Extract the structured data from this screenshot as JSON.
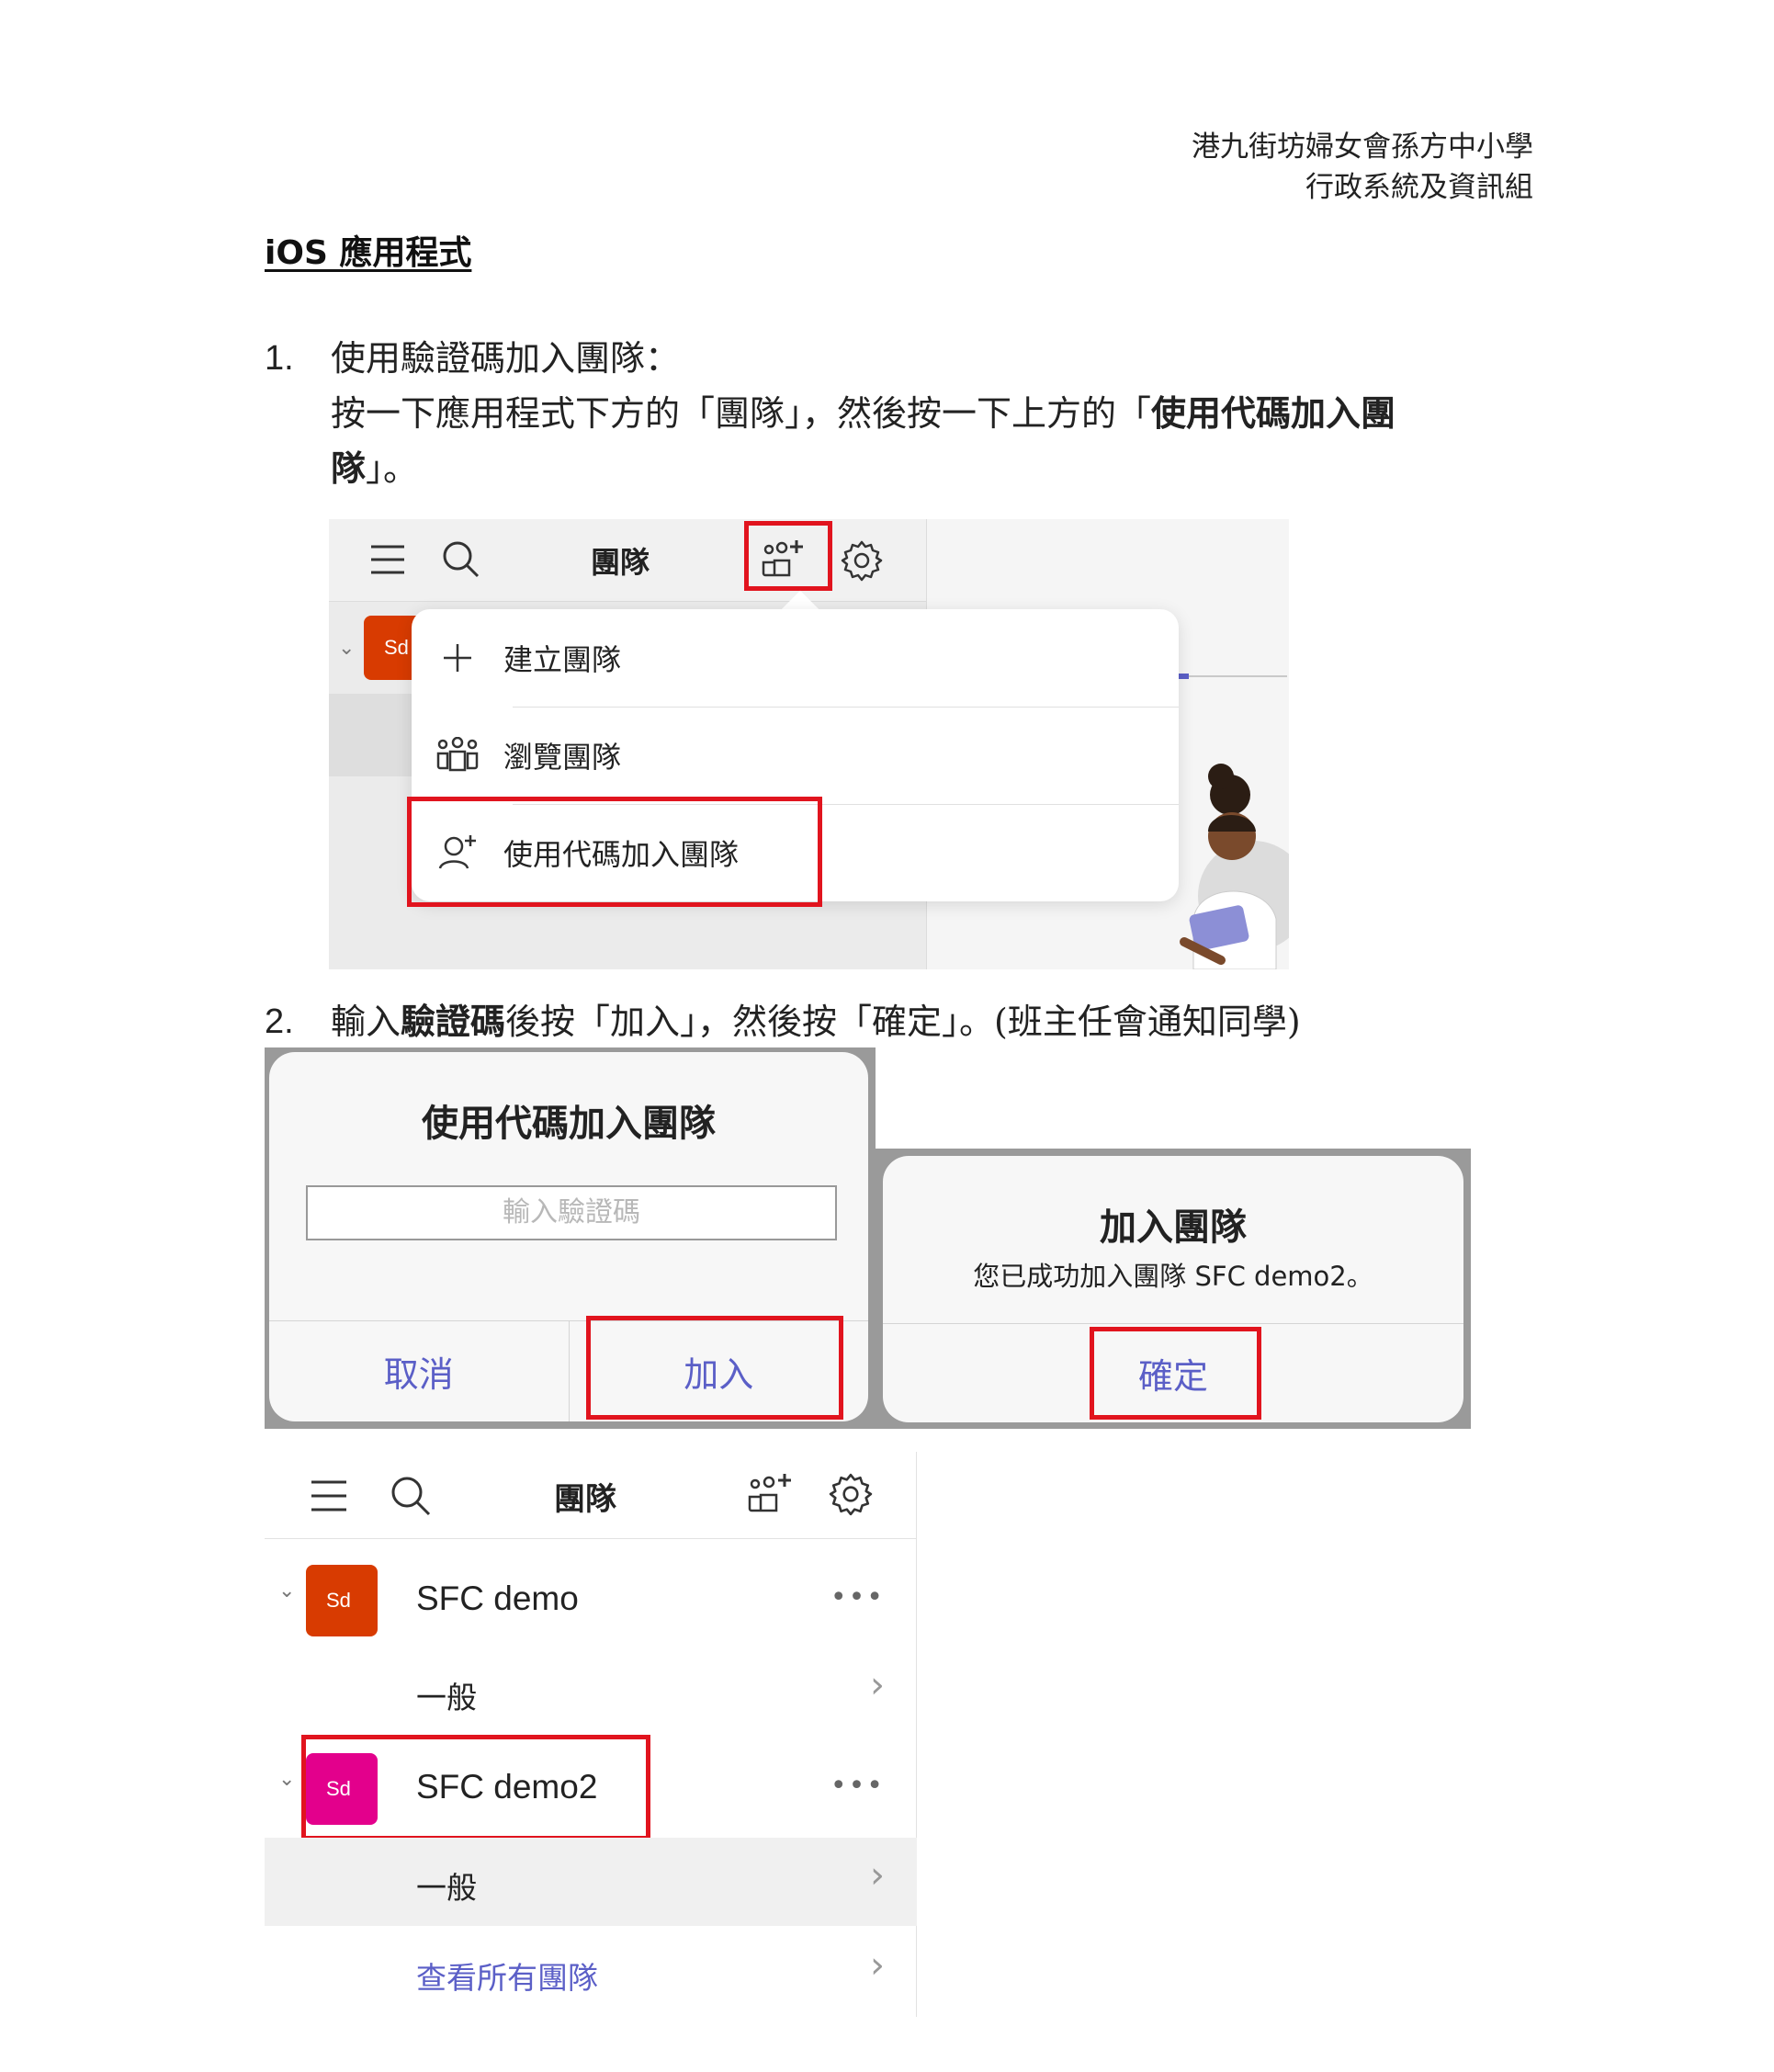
{
  "header": {
    "school_name": "港九街坊婦女會孫方中小學",
    "department": "行政系統及資訊組"
  },
  "section_title": "iOS 應用程式",
  "step1": {
    "number": "1.",
    "heading": "使用驗證碼加入團隊：",
    "instruction_before": "按一下應用程式下方的「團隊」，然後按一下上方的「",
    "instruction_bold": "使用代碼加入團隊",
    "instruction_after": "」。"
  },
  "step2": {
    "number": "2.",
    "text_before": "輸入",
    "text_bold": "驗證碼",
    "text_after": "後按「加入」，然後按「確定」。(班主任會通知同學)"
  },
  "screenshot1": {
    "header_title": "團隊",
    "team_badge": "Sd",
    "menu_items": [
      {
        "icon": "plus-icon",
        "label": "建立團隊"
      },
      {
        "icon": "browse-teams-icon",
        "label": "瀏覽團隊"
      },
      {
        "icon": "join-with-code-icon",
        "label": "使用代碼加入團隊"
      }
    ]
  },
  "screenshot2": {
    "dialog_title": "使用代碼加入團隊",
    "input_placeholder": "輸入驗證碼",
    "cancel_label": "取消",
    "join_label": "加入"
  },
  "screenshot3": {
    "dialog_title": "加入團隊",
    "message": "您已成功加入團隊 SFC demo2。",
    "ok_label": "確定"
  },
  "screenshot4": {
    "header_title": "團隊",
    "teams": [
      {
        "badge": "Sd",
        "name": "SFC demo",
        "channel": "一般",
        "badge_color": "#d83b01"
      },
      {
        "badge": "Sd",
        "name": "SFC demo2",
        "channel": "一般",
        "badge_color": "#e3008c"
      }
    ],
    "more_label": "•••",
    "view_all": "查看所有團隊"
  },
  "colors": {
    "highlight_red": "#e1141e",
    "teams_purple": "#5b5fc7"
  }
}
